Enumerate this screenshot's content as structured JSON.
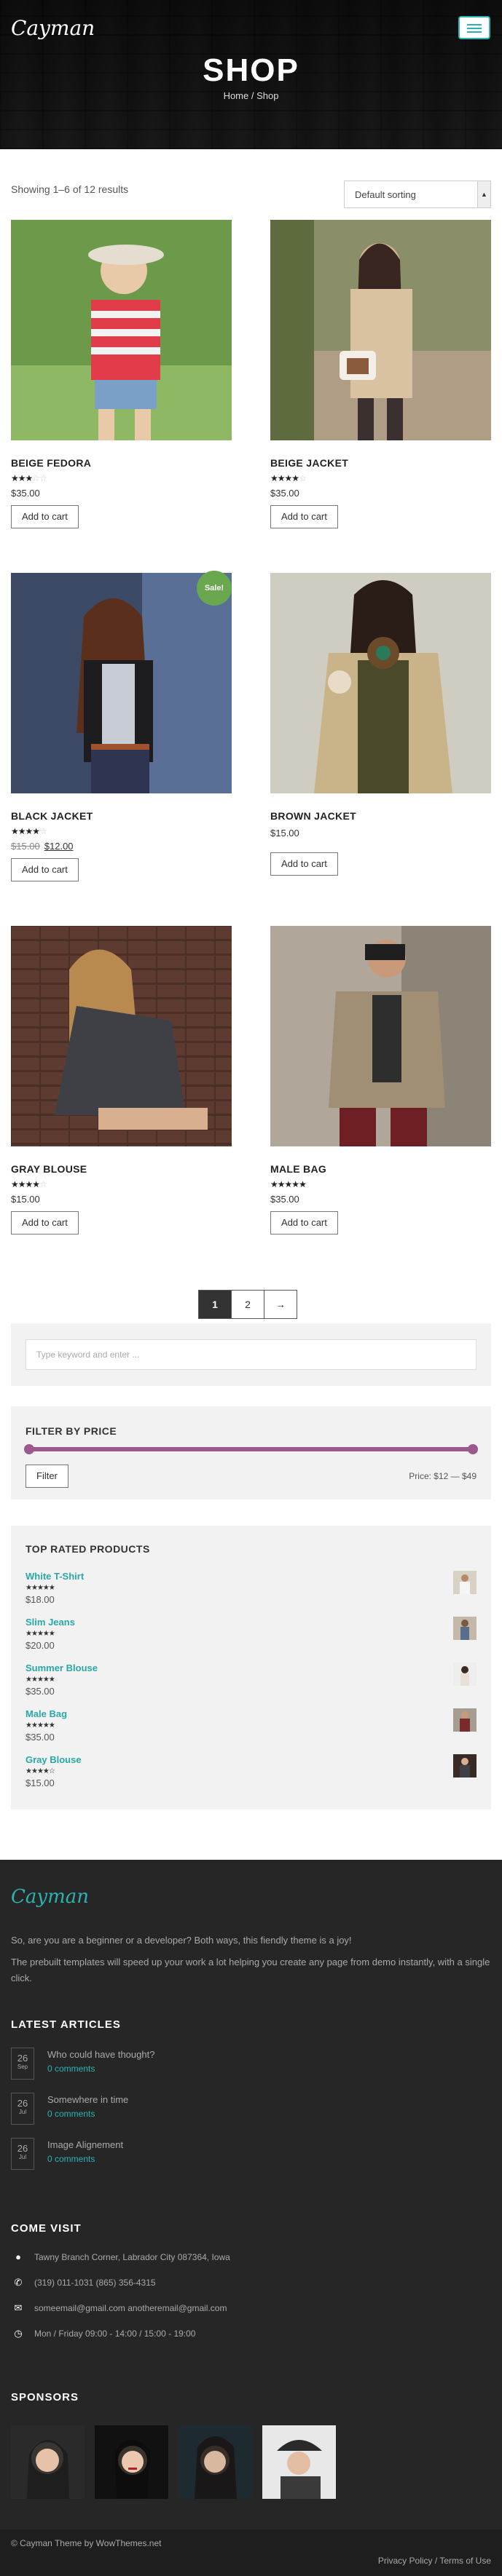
{
  "header": {
    "logo": "Cayman",
    "title": "SHOP",
    "breadcrumb": "Home / Shop"
  },
  "toolbar": {
    "results": "Showing 1–6 of 12 results",
    "sorting": "Default sorting"
  },
  "products": [
    {
      "name": "BEIGE FEDORA",
      "rating": 3,
      "price": "$35.00",
      "old_price": "",
      "button": "Add to cart",
      "sale": ""
    },
    {
      "name": "BEIGE JACKET",
      "rating": 4,
      "price": "$35.00",
      "old_price": "",
      "button": "Add to cart",
      "sale": ""
    },
    {
      "name": "BLACK JACKET",
      "rating": 4,
      "price": "$12.00",
      "old_price": "$15.00",
      "button": "Add to cart",
      "sale": "Sale!"
    },
    {
      "name": "BROWN JACKET",
      "rating": 0,
      "price": "$15.00",
      "old_price": "",
      "button": "Add to cart",
      "sale": ""
    },
    {
      "name": "GRAY BLOUSE",
      "rating": 4,
      "price": "$15.00",
      "old_price": "",
      "button": "Add to cart",
      "sale": ""
    },
    {
      "name": "MALE BAG",
      "rating": 5,
      "price": "$35.00",
      "old_price": "",
      "button": "Add to cart",
      "sale": ""
    }
  ],
  "pagination": {
    "pages": [
      "1",
      "2"
    ],
    "next": "→"
  },
  "search": {
    "placeholder": "Type keyword and enter ..."
  },
  "price_filter": {
    "title": "FILTER BY PRICE",
    "button": "Filter",
    "range": "Price: $12 — $49"
  },
  "top_rated": {
    "title": "TOP RATED PRODUCTS",
    "items": [
      {
        "name": "White T-Shirt",
        "price": "$18.00",
        "rating": 5
      },
      {
        "name": "Slim Jeans",
        "price": "$20.00",
        "rating": 5
      },
      {
        "name": "Summer Blouse",
        "price": "$35.00",
        "rating": 5
      },
      {
        "name": "Male Bag",
        "price": "$35.00",
        "rating": 5
      },
      {
        "name": "Gray Blouse",
        "price": "$15.00",
        "rating": 4
      }
    ]
  },
  "footer": {
    "logo": "Cayman",
    "intro1": "So, are you are a beginner or a developer? Both ways, this fiendly theme is a joy!",
    "intro2": "The prebuilt templates will speed up your work a lot helping you create any page from demo instantly, with a single click.",
    "articles_title": "LATEST ARTICLES",
    "articles": [
      {
        "day": "26",
        "month": "Sep",
        "title": "Who could have thought?",
        "comments": "0 comments"
      },
      {
        "day": "26",
        "month": "Jul",
        "title": "Somewhere in time",
        "comments": "0 comments"
      },
      {
        "day": "26",
        "month": "Jul",
        "title": "Image Alignement",
        "comments": "0 comments"
      }
    ],
    "visit_title": "COME VISIT",
    "address": "Tawny Branch Corner, Labrador City 087364, Iowa",
    "phone": "(319) 011-1031 (865) 356-4315",
    "emails": "someemail@gmail.com anotheremail@gmail.com",
    "hours": "Mon / Friday 09:00 - 14:00 / 15:00 - 19:00",
    "sponsors_title": "SPONSORS",
    "copyright": "© Cayman Theme by WowThemes.net",
    "legal": "Privacy Policy / Terms of Use"
  }
}
